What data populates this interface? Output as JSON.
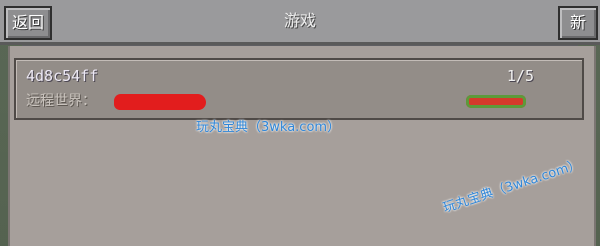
{
  "header": {
    "back_label": "返回",
    "title": "游戏",
    "new_label": "新"
  },
  "worlds": [
    {
      "name": "4d8c54ff",
      "players": "1/5",
      "type_label": "远程世界："
    }
  ],
  "watermark": {
    "text": "玩丸宝典（3wka.com）"
  },
  "colors": {
    "redaction": "#e21d1d",
    "top_bar": "#9a9a9c",
    "panel": "#a69f9b"
  }
}
